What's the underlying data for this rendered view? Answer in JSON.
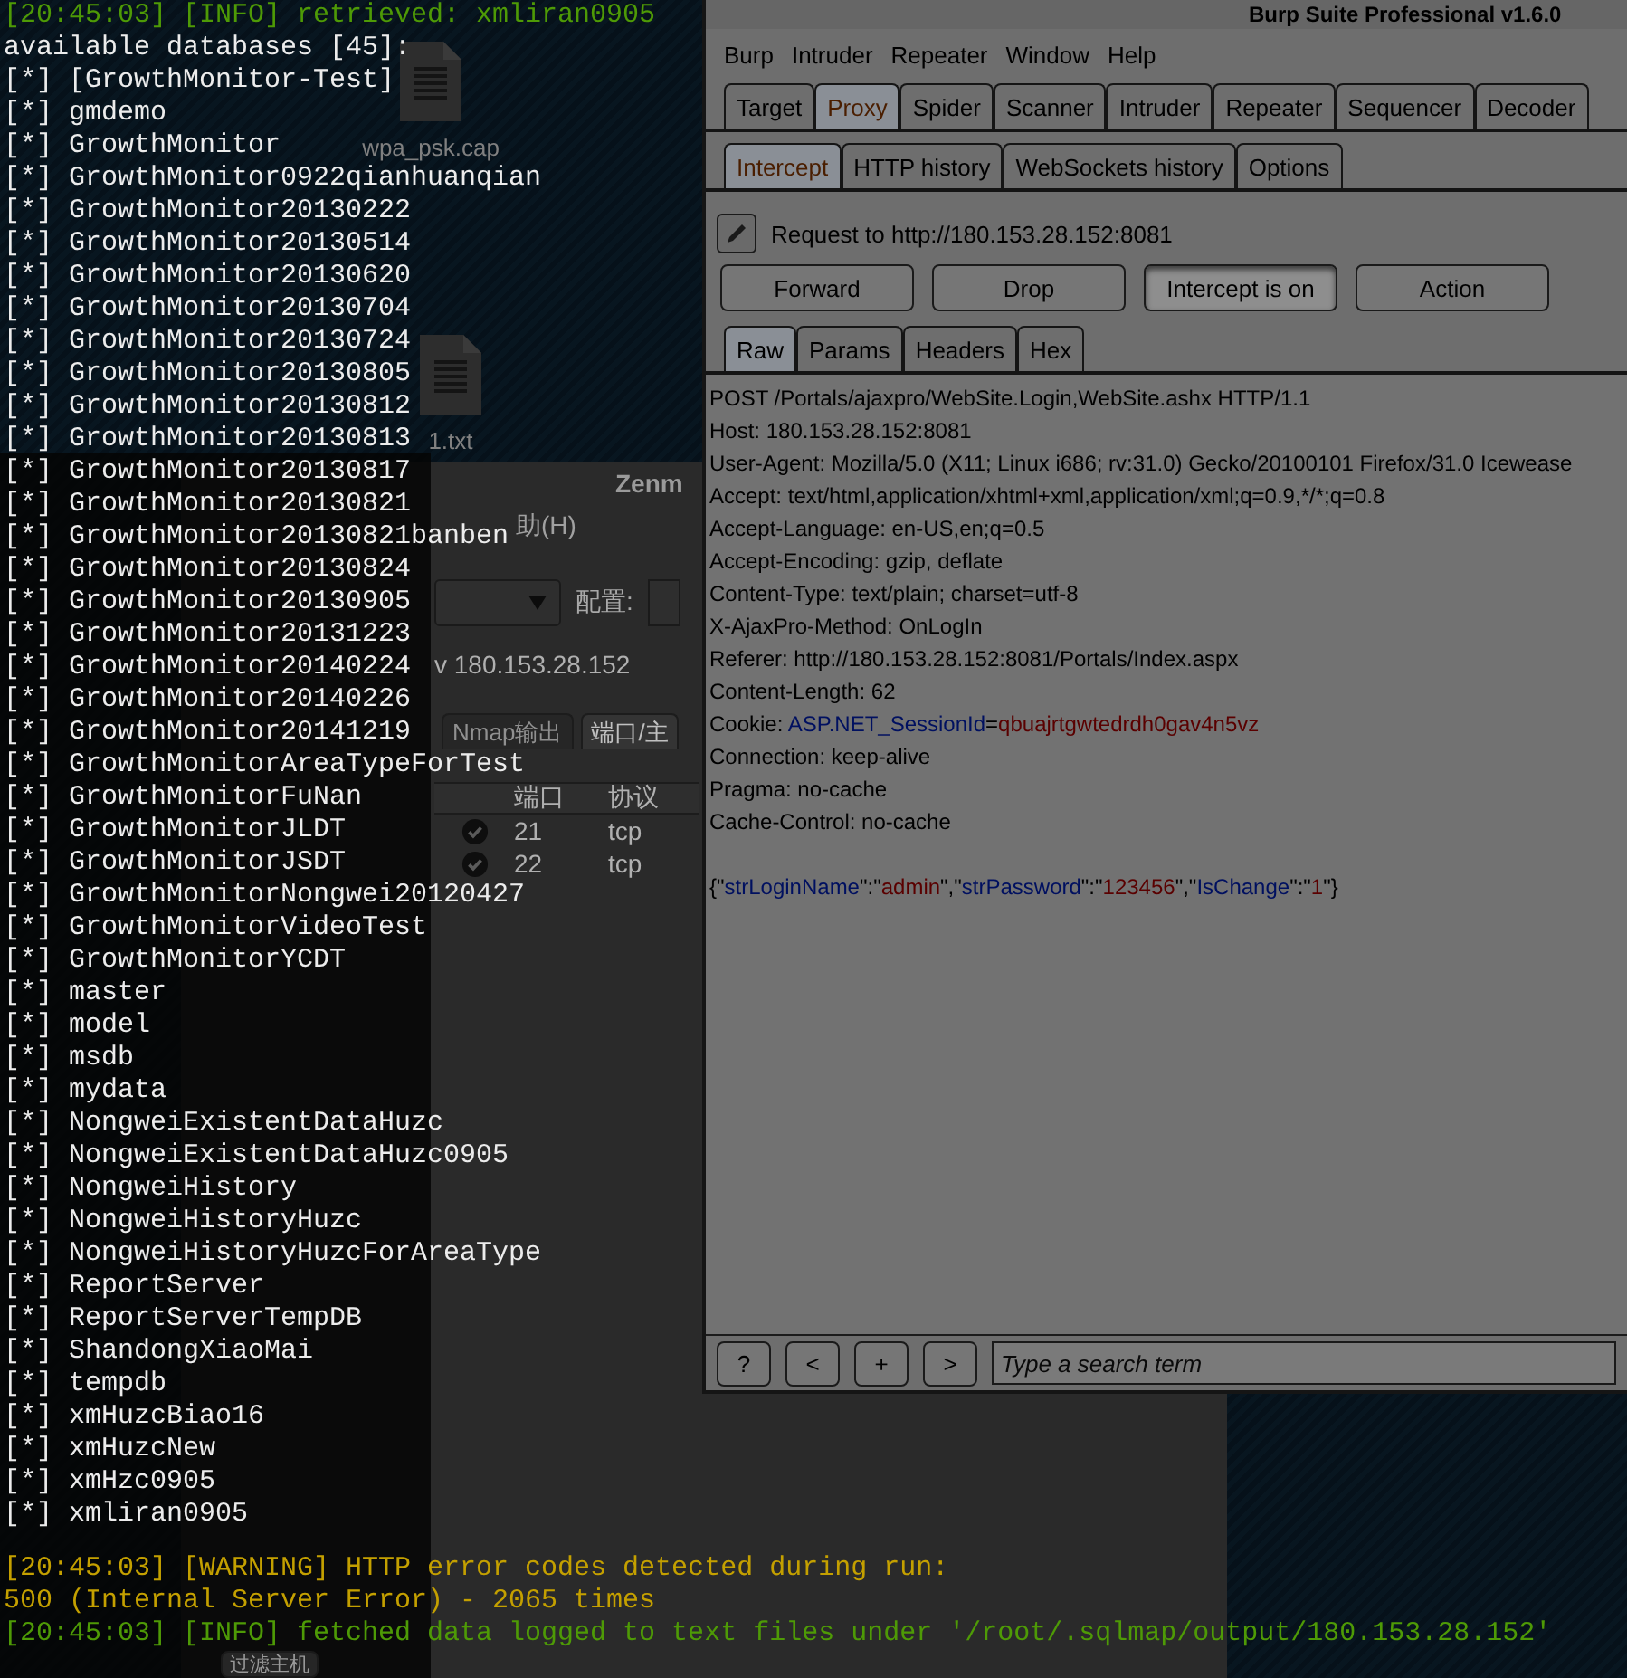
{
  "terminal": {
    "lines": [
      {
        "kind": "info",
        "text": "[20:45:03] [INFO] retrieved: xmliran0905"
      },
      {
        "kind": "plain",
        "text": "available databases [45]:"
      },
      {
        "kind": "item",
        "marker": "[*]",
        "text": "[GrowthMonitor-Test]"
      },
      {
        "kind": "item",
        "marker": "[*]",
        "text": "gmdemo"
      },
      {
        "kind": "item",
        "marker": "[*]",
        "text": "GrowthMonitor"
      },
      {
        "kind": "item",
        "marker": "[*]",
        "text": "GrowthMonitor0922qianhuanqian"
      },
      {
        "kind": "item",
        "marker": "[*]",
        "text": "GrowthMonitor20130222"
      },
      {
        "kind": "item",
        "marker": "[*]",
        "text": "GrowthMonitor20130514"
      },
      {
        "kind": "item",
        "marker": "[*]",
        "text": "GrowthMonitor20130620"
      },
      {
        "kind": "item",
        "marker": "[*]",
        "text": "GrowthMonitor20130704"
      },
      {
        "kind": "item",
        "marker": "[*]",
        "text": "GrowthMonitor20130724"
      },
      {
        "kind": "item",
        "marker": "[*]",
        "text": "GrowthMonitor20130805"
      },
      {
        "kind": "item",
        "marker": "[*]",
        "text": "GrowthMonitor20130812"
      },
      {
        "kind": "item",
        "marker": "[*]",
        "text": "GrowthMonitor20130813"
      },
      {
        "kind": "item",
        "marker": "[*]",
        "text": "GrowthMonitor20130817"
      },
      {
        "kind": "item",
        "marker": "[*]",
        "text": "GrowthMonitor20130821"
      },
      {
        "kind": "item",
        "marker": "[*]",
        "text": "GrowthMonitor20130821banben"
      },
      {
        "kind": "item",
        "marker": "[*]",
        "text": "GrowthMonitor20130824"
      },
      {
        "kind": "item",
        "marker": "[*]",
        "text": "GrowthMonitor20130905"
      },
      {
        "kind": "item",
        "marker": "[*]",
        "text": "GrowthMonitor20131223"
      },
      {
        "kind": "item",
        "marker": "[*]",
        "text": "GrowthMonitor20140224"
      },
      {
        "kind": "item",
        "marker": "[*]",
        "text": "GrowthMonitor20140226"
      },
      {
        "kind": "item",
        "marker": "[*]",
        "text": "GrowthMonitor20141219"
      },
      {
        "kind": "item",
        "marker": "[*]",
        "text": "GrowthMonitorAreaTypeForTest"
      },
      {
        "kind": "item",
        "marker": "[*]",
        "text": "GrowthMonitorFuNan"
      },
      {
        "kind": "item",
        "marker": "[*]",
        "text": "GrowthMonitorJLDT"
      },
      {
        "kind": "item",
        "marker": "[*]",
        "text": "GrowthMonitorJSDT"
      },
      {
        "kind": "item",
        "marker": "[*]",
        "text": "GrowthMonitorNongwei20120427"
      },
      {
        "kind": "item",
        "marker": "[*]",
        "text": "GrowthMonitorVideoTest"
      },
      {
        "kind": "item",
        "marker": "[*]",
        "text": "GrowthMonitorYCDT"
      },
      {
        "kind": "item",
        "marker": "[*]",
        "text": "master"
      },
      {
        "kind": "item",
        "marker": "[*]",
        "text": "model"
      },
      {
        "kind": "item",
        "marker": "[*]",
        "text": "msdb"
      },
      {
        "kind": "item",
        "marker": "[*]",
        "text": "mydata"
      },
      {
        "kind": "item",
        "marker": "[*]",
        "text": "NongweiExistentDataHuzc"
      },
      {
        "kind": "item",
        "marker": "[*]",
        "text": "NongweiExistentDataHuzc0905"
      },
      {
        "kind": "item",
        "marker": "[*]",
        "text": "NongweiHistory"
      },
      {
        "kind": "item",
        "marker": "[*]",
        "text": "NongweiHistoryHuzc"
      },
      {
        "kind": "item",
        "marker": "[*]",
        "text": "NongweiHistoryHuzcForAreaType"
      },
      {
        "kind": "item",
        "marker": "[*]",
        "text": "ReportServer"
      },
      {
        "kind": "item",
        "marker": "[*]",
        "text": "ReportServerTempDB"
      },
      {
        "kind": "item",
        "marker": "[*]",
        "text": "ShandongXiaoMai"
      },
      {
        "kind": "item",
        "marker": "[*]",
        "text": "tempdb"
      },
      {
        "kind": "item",
        "marker": "[*]",
        "text": "xmHuzcBiao16"
      },
      {
        "kind": "item",
        "marker": "[*]",
        "text": "xmHuzcNew"
      },
      {
        "kind": "item",
        "marker": "[*]",
        "text": "xmHzc0905"
      },
      {
        "kind": "item",
        "marker": "[*]",
        "text": "xmliran0905"
      },
      {
        "kind": "blank"
      },
      {
        "kind": "warning",
        "text": "[20:45:03] [WARNING] HTTP error codes detected during run:"
      },
      {
        "kind": "warning",
        "text": "500 (Internal Server Error) - 2065 times"
      },
      {
        "kind": "info",
        "text": "[20:45:03] [INFO] fetched data logged to text files under '/root/.sqlmap/output/180.153.28.152'"
      }
    ]
  },
  "desktop_icons": [
    {
      "label": "wpa_psk.cap"
    },
    {
      "label": "1.txt"
    }
  ],
  "zenmap": {
    "title": "Zenm",
    "menu": [
      "助(H)"
    ],
    "profile_label": "配置:",
    "command": "v 180.153.28.152",
    "tabs": [
      {
        "label": "Nmap输出",
        "selected": false
      },
      {
        "label": "端口/主",
        "selected": true
      }
    ],
    "columns": [
      "端口",
      "协议"
    ],
    "rows": [
      {
        "port": "21",
        "protocol": "tcp"
      },
      {
        "port": "22",
        "protocol": "tcp"
      }
    ],
    "filter_button": "过滤主机"
  },
  "burp": {
    "title": "Burp Suite Professional v1.6.0",
    "menu": [
      "Burp",
      "Intruder",
      "Repeater",
      "Window",
      "Help"
    ],
    "tabs": [
      {
        "label": "Target",
        "selected": false
      },
      {
        "label": "Proxy",
        "selected": true
      },
      {
        "label": "Spider",
        "selected": false
      },
      {
        "label": "Scanner",
        "selected": false
      },
      {
        "label": "Intruder",
        "selected": false
      },
      {
        "label": "Repeater",
        "selected": false
      },
      {
        "label": "Sequencer",
        "selected": false
      },
      {
        "label": "Decoder",
        "selected": false
      }
    ],
    "subtabs": [
      {
        "label": "Intercept",
        "selected": true
      },
      {
        "label": "HTTP history",
        "selected": false
      },
      {
        "label": "WebSockets history",
        "selected": false
      },
      {
        "label": "Options",
        "selected": false
      }
    ],
    "request_label": "Request to http://180.153.28.152:8081",
    "buttons": [
      {
        "label": "Forward",
        "pressed": false
      },
      {
        "label": "Drop",
        "pressed": false
      },
      {
        "label": "Intercept is on",
        "pressed": true
      },
      {
        "label": "Action",
        "pressed": false
      }
    ],
    "view_tabs": [
      {
        "label": "Raw",
        "selected": true
      },
      {
        "label": "Params",
        "selected": false
      },
      {
        "label": "Headers",
        "selected": false
      },
      {
        "label": "Hex",
        "selected": false
      }
    ],
    "request_lines": [
      {
        "kind": "text",
        "segments": [
          {
            "kind": "plain",
            "text": "POST /Portals/ajaxpro/WebSite.Login,WebSite.ashx HTTP/1.1"
          }
        ]
      },
      {
        "kind": "text",
        "segments": [
          {
            "kind": "plain",
            "text": "Host: 180.153.28.152:8081"
          }
        ]
      },
      {
        "kind": "text",
        "segments": [
          {
            "kind": "plain",
            "text": "User-Agent: Mozilla/5.0 (X11; Linux i686; rv:31.0) Gecko/20100101 Firefox/31.0 Icewease"
          }
        ]
      },
      {
        "kind": "text",
        "segments": [
          {
            "kind": "plain",
            "text": "Accept: text/html,application/xhtml+xml,application/xml;q=0.9,*/*;q=0.8"
          }
        ]
      },
      {
        "kind": "text",
        "segments": [
          {
            "kind": "plain",
            "text": "Accept-Language: en-US,en;q=0.5"
          }
        ]
      },
      {
        "kind": "text",
        "segments": [
          {
            "kind": "plain",
            "text": "Accept-Encoding: gzip, deflate"
          }
        ]
      },
      {
        "kind": "text",
        "segments": [
          {
            "kind": "plain",
            "text": "Content-Type: text/plain; charset=utf-8"
          }
        ]
      },
      {
        "kind": "text",
        "segments": [
          {
            "kind": "plain",
            "text": "X-AjaxPro-Method: OnLogIn"
          }
        ]
      },
      {
        "kind": "text",
        "segments": [
          {
            "kind": "plain",
            "text": "Referer: http://180.153.28.152:8081/Portals/Index.aspx"
          }
        ]
      },
      {
        "kind": "text",
        "segments": [
          {
            "kind": "plain",
            "text": "Content-Length: 62"
          }
        ]
      },
      {
        "kind": "text",
        "segments": [
          {
            "kind": "plain",
            "text": "Cookie: "
          },
          {
            "kind": "name",
            "text": "ASP.NET_SessionId"
          },
          {
            "kind": "plain",
            "text": "="
          },
          {
            "kind": "value",
            "text": "qbuajrtgwtedrdh0gav4n5vz"
          }
        ]
      },
      {
        "kind": "text",
        "segments": [
          {
            "kind": "plain",
            "text": "Connection: keep-alive"
          }
        ]
      },
      {
        "kind": "text",
        "segments": [
          {
            "kind": "plain",
            "text": "Pragma: no-cache"
          }
        ]
      },
      {
        "kind": "text",
        "segments": [
          {
            "kind": "plain",
            "text": "Cache-Control: no-cache"
          }
        ]
      },
      {
        "kind": "blank"
      },
      {
        "kind": "text",
        "segments": [
          {
            "kind": "plain",
            "text": "{\""
          },
          {
            "kind": "name",
            "text": "strLoginName"
          },
          {
            "kind": "plain",
            "text": "\":\""
          },
          {
            "kind": "value",
            "text": "admin"
          },
          {
            "kind": "plain",
            "text": "\",\""
          },
          {
            "kind": "name",
            "text": "strPassword"
          },
          {
            "kind": "plain",
            "text": "\":\""
          },
          {
            "kind": "value",
            "text": "123456"
          },
          {
            "kind": "plain",
            "text": "\",\""
          },
          {
            "kind": "name",
            "text": "IsChange"
          },
          {
            "kind": "plain",
            "text": "\":\""
          },
          {
            "kind": "value",
            "text": "1"
          },
          {
            "kind": "plain",
            "text": "\"}"
          }
        ]
      }
    ],
    "nav_buttons": [
      "?",
      "<",
      "+",
      ">"
    ],
    "search": {
      "placeholder": "Type a search term"
    }
  }
}
